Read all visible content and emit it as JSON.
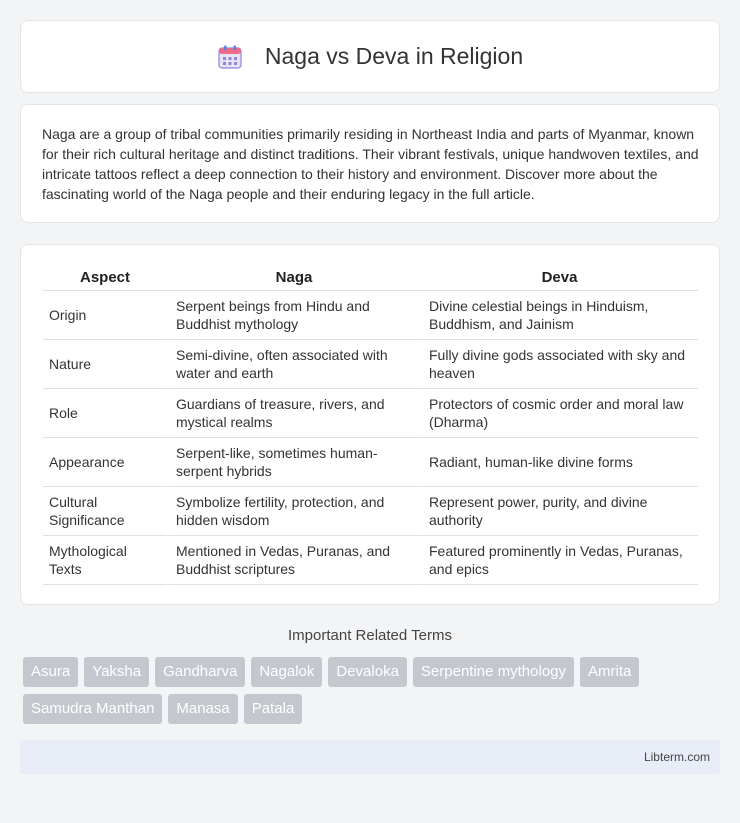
{
  "header": {
    "title": "Naga vs Deva in Religion",
    "icon": "calendar-icon"
  },
  "intro": "Naga are a group of tribal communities primarily residing in Northeast India and parts of Myanmar, known for their rich cultural heritage and distinct traditions. Their vibrant festivals, unique handwoven textiles, and intricate tattoos reflect a deep connection to their history and environment. Discover more about the fascinating world of the Naga people and their enduring legacy in the full article.",
  "table": {
    "headers": [
      "Aspect",
      "Naga",
      "Deva"
    ],
    "rows": [
      [
        "Origin",
        "Serpent beings from Hindu and Buddhist mythology",
        "Divine celestial beings in Hinduism, Buddhism, and Jainism"
      ],
      [
        "Nature",
        "Semi-divine, often associated with water and earth",
        "Fully divine gods associated with sky and heaven"
      ],
      [
        "Role",
        "Guardians of treasure, rivers, and mystical realms",
        "Protectors of cosmic order and moral law (Dharma)"
      ],
      [
        "Appearance",
        "Serpent-like, sometimes human-serpent hybrids",
        "Radiant, human-like divine forms"
      ],
      [
        "Cultural Significance",
        "Symbolize fertility, protection, and hidden wisdom",
        "Represent power, purity, and divine authority"
      ],
      [
        "Mythological Texts",
        "Mentioned in Vedas, Puranas, and Buddhist scriptures",
        "Featured prominently in Vedas, Puranas, and epics"
      ]
    ]
  },
  "terms": {
    "title": "Important Related Terms",
    "items": [
      "Asura",
      "Yaksha",
      "Gandharva",
      "Nagalok",
      "Devaloka",
      "Serpentine mythology",
      "Amrita",
      "Samudra Manthan",
      "Manasa",
      "Patala"
    ]
  },
  "footer": {
    "text": "Libterm.com"
  },
  "colors": {
    "tag_bg": "#c4c7ce",
    "footer_bg": "#e8edf8",
    "page_bg": "#f3f4f6"
  }
}
